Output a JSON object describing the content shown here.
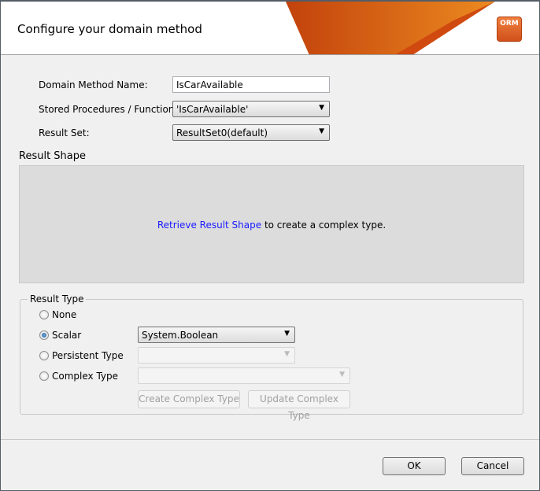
{
  "dialog": {
    "title": "Configure your domain method",
    "logo_text": "ORM"
  },
  "form": {
    "method_name_label": "Domain Method Name:",
    "method_name_value": "IsCarAvailable",
    "procedures_label": "Stored Procedures / Functions",
    "procedures_value": "'IsCarAvailable'",
    "result_set_label": "Result Set:",
    "result_set_value": "ResultSet0(default)"
  },
  "result_shape": {
    "title": "Result Shape",
    "link": "Retrieve Result Shape",
    "text": " to create a complex type."
  },
  "result_type": {
    "title": "Result Type",
    "options": [
      {
        "label": "None",
        "checked": false
      },
      {
        "label": "Scalar",
        "checked": true
      },
      {
        "label": "Persistent Type",
        "checked": false
      },
      {
        "label": "Complex Type",
        "checked": false
      }
    ],
    "scalar_value": "System.Boolean",
    "create_label": "Create Complex Type",
    "update_label": "Update Complex Type"
  },
  "buttons": {
    "ok": "OK",
    "cancel": "Cancel"
  }
}
